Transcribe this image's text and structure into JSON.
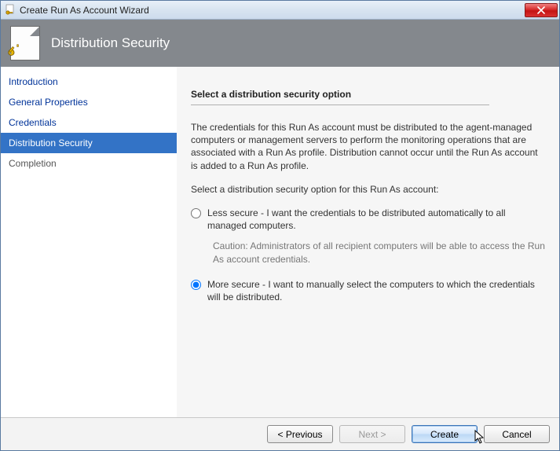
{
  "window": {
    "title": "Create Run As Account Wizard"
  },
  "header": {
    "title": "Distribution Security"
  },
  "sidebar": {
    "items": [
      {
        "label": "Introduction",
        "active": false
      },
      {
        "label": "General Properties",
        "active": false
      },
      {
        "label": "Credentials",
        "active": false
      },
      {
        "label": "Distribution Security",
        "active": true
      },
      {
        "label": "Completion",
        "active": false
      }
    ]
  },
  "main": {
    "heading": "Select a distribution security option",
    "intro": "The credentials for this Run As account must be distributed to the agent-managed computers or management servers to perform the monitoring operations that are associated with a Run As profile. Distribution cannot occur until the Run As account is added to a Run As profile.",
    "prompt": "Select a distribution security option for this Run As account:",
    "options": {
      "less": {
        "label": "Less secure - I want the credentials to be distributed automatically to all managed computers.",
        "caution": "Caution: Administrators of all recipient computers will be able to access the Run As account credentials.",
        "selected": false
      },
      "more": {
        "label": "More secure - I want to manually select the computers to which the credentials will be distributed.",
        "selected": true
      }
    }
  },
  "footer": {
    "previous": "< Previous",
    "next": "Next >",
    "create": "Create",
    "cancel": "Cancel",
    "next_enabled": false
  }
}
